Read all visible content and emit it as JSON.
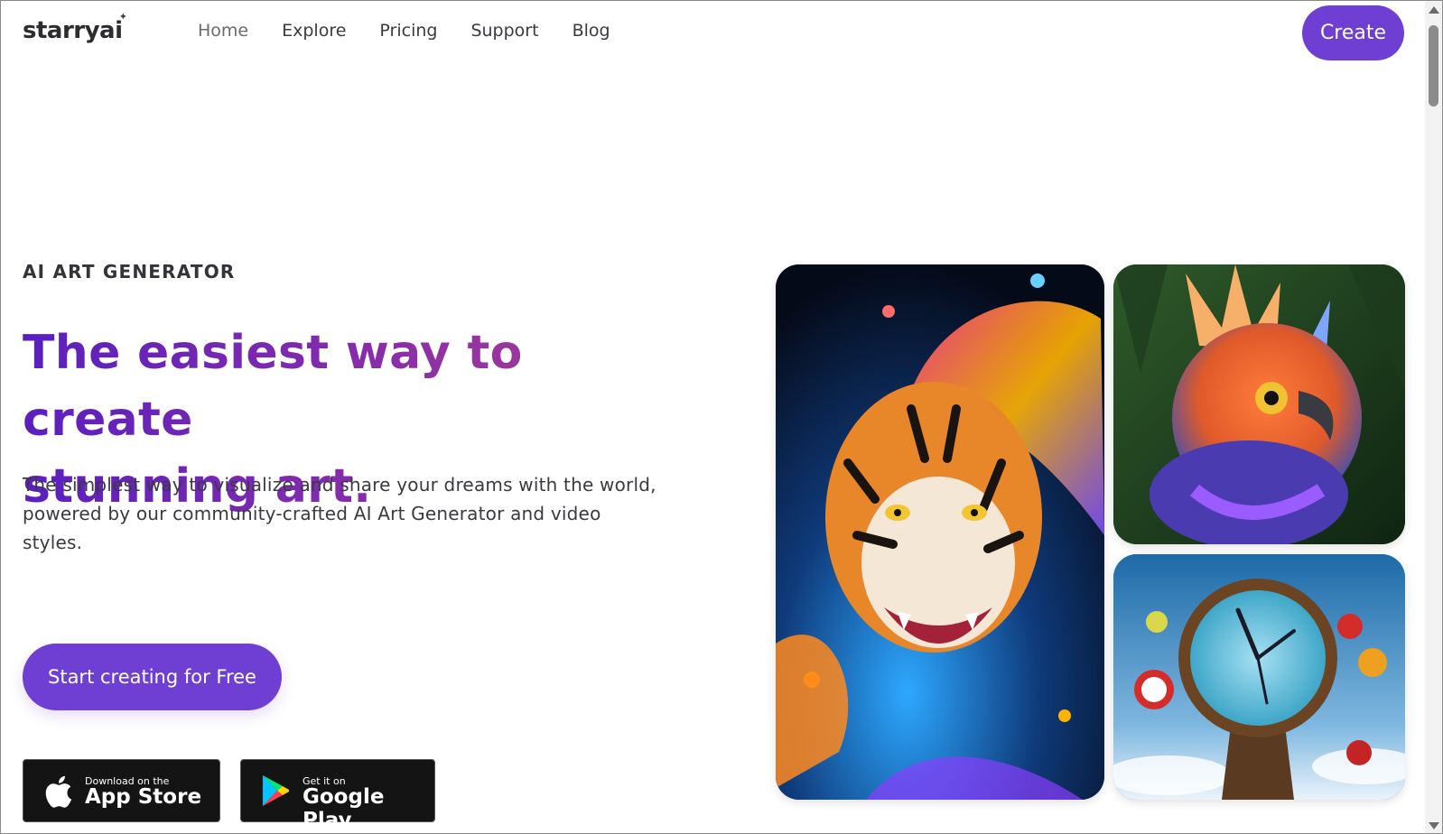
{
  "header": {
    "logo": "starryai",
    "nav": [
      "Home",
      "Explore",
      "Pricing",
      "Support",
      "Blog"
    ],
    "create_label": "Create"
  },
  "hero": {
    "eyebrow": "AI ART GENERATOR",
    "headline_line1": "The easiest way to create",
    "headline_line2": "stunning art.",
    "subtext": "The simplest way to visualize and share your dreams with the world, powered by our community-crafted AI Art Generator and video styles.",
    "cta_label": "Start creating for Free"
  },
  "stores": {
    "apple_small": "Download on the",
    "apple_big": "App Store",
    "google_small": "Get it on",
    "google_big": "Google Play"
  },
  "colors": {
    "accent": "#6e3fd2",
    "headline_gradient_start": "#5a1fbf",
    "headline_gradient_end": "#b0408f"
  },
  "icons": {
    "apple": "apple-icon",
    "google_play": "google-play-icon",
    "sparkle": "sparkle-icon"
  }
}
